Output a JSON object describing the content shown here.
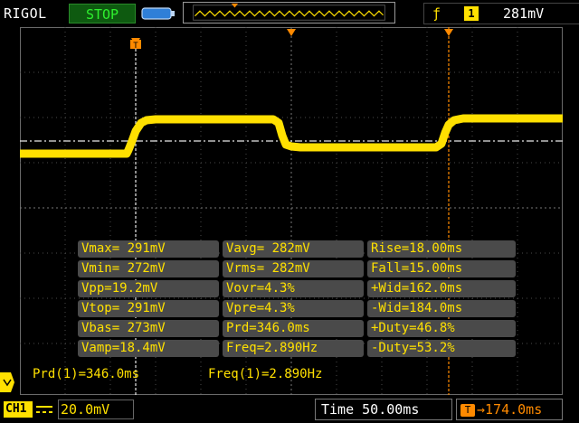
{
  "header": {
    "brand": "RIGOL",
    "run_state": "STOP",
    "trigger": {
      "edge_icon": "rising-edge-icon",
      "channel": "1",
      "level": "281mV"
    }
  },
  "colors": {
    "trace": "#ffe000",
    "trigger_marker": "#ff8a00",
    "status_green": "#2ef02e",
    "grid": "#5a5a5a",
    "panel": "#4a4a4a"
  },
  "measurements": {
    "rows": [
      [
        "Vmax= 291mV",
        "Vavg= 282mV",
        "Rise=18.00ms"
      ],
      [
        "Vmin= 272mV",
        "Vrms= 282mV",
        "Fall=15.00ms"
      ],
      [
        "Vpp=19.2mV",
        "Vovr=4.3%",
        "+Wid=162.0ms"
      ],
      [
        "Vtop= 291mV",
        "Vpre=4.3%",
        "-Wid=184.0ms"
      ],
      [
        "Vbas= 273mV",
        "Prd=346.0ms",
        "+Duty=46.8%"
      ],
      [
        "Vamp=18.4mV",
        "Freq=2.890Hz",
        "-Duty=53.2%"
      ]
    ]
  },
  "cursor_readouts": {
    "period": "Prd(1)=346.0ms",
    "frequency": "Freq(1)=2.890Hz"
  },
  "footer": {
    "channel": "CH1",
    "coupling_icon": "dc-coupling-icon",
    "volts_per_div": "20.0mV",
    "timebase": "Time 50.00ms",
    "trigger_offset": "174.0ms",
    "offset_icon": "trigger-offset-icon"
  }
}
